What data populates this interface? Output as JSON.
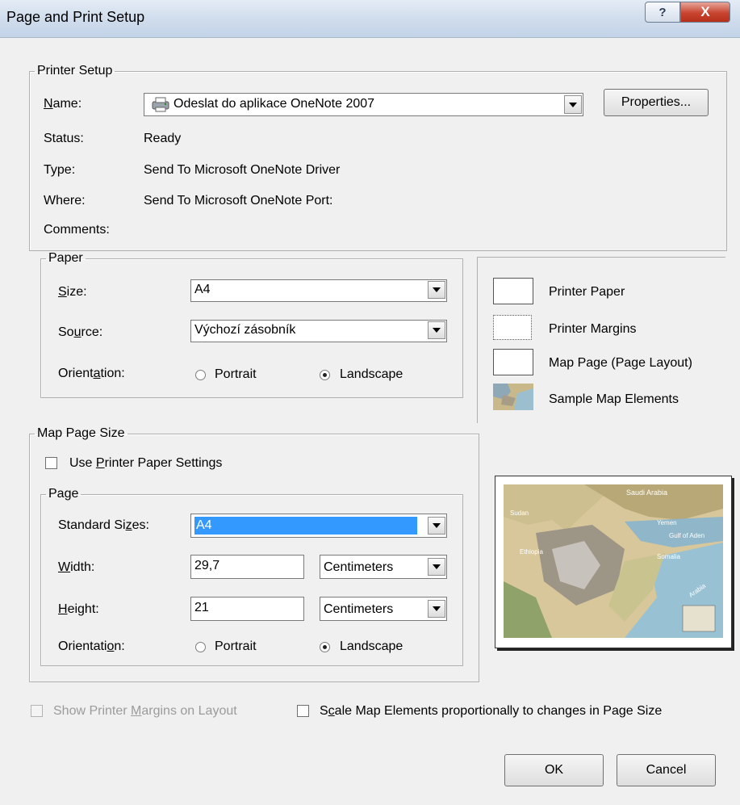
{
  "window": {
    "title": "Page and Print Setup",
    "help_label": "?",
    "close_label": "X"
  },
  "printer_setup": {
    "group_label": "Printer Setup",
    "name_label": "Name:",
    "name_value": "Odeslat do aplikace OneNote 2007",
    "properties_label": "Properties...",
    "status_label": "Status:",
    "status_value": "Ready",
    "type_label": "Type:",
    "type_value": "Send To Microsoft OneNote Driver",
    "where_label": "Where:",
    "where_value": "Send To Microsoft OneNote Port:",
    "comments_label": "Comments:",
    "comments_value": ""
  },
  "paper": {
    "group_label": "Paper",
    "size_label": "Size:",
    "size_value": "A4",
    "source_label": "Source:",
    "source_value": "Výchozí zásobník",
    "orientation_label": "Orientation:",
    "portrait_label": "Portrait",
    "landscape_label": "Landscape",
    "selected": "Landscape"
  },
  "legend": {
    "printer_paper": "Printer Paper",
    "printer_margins": "Printer Margins",
    "map_page": "Map Page (Page Layout)",
    "sample_elements": "Sample Map Elements"
  },
  "map_page_size": {
    "group_label": "Map Page Size",
    "use_printer_paper_label": "Use Printer Paper Settings",
    "use_printer_paper_checked": false,
    "page_group_label": "Page",
    "standard_sizes_label": "Standard Sizes:",
    "standard_sizes_value": "A4",
    "width_label": "Width:",
    "width_value": "29,7",
    "width_unit": "Centimeters",
    "height_label": "Height:",
    "height_value": "21",
    "height_unit": "Centimeters",
    "orientation_label": "Orientation:",
    "portrait_label": "Portrait",
    "landscape_label": "Landscape",
    "selected": "Landscape"
  },
  "preview_map_labels": {
    "saudi": "Saudi Arabia",
    "yemen": "Yemen",
    "sudan": "Sudan",
    "gulf": "Gulf of Aden",
    "somalia": "Somalia",
    "ethiopia": "Ethiopia",
    "arabian_sea": "Arabia"
  },
  "footer": {
    "show_margins_label": "Show Printer Margins on Layout",
    "scale_elements_label": "Scale Map Elements proportionally to changes in Page Size",
    "ok_label": "OK",
    "cancel_label": "Cancel"
  },
  "colors": {
    "selection": "#3399ff",
    "title_bar": "#cfdcec",
    "close_button": "#c8442f"
  }
}
